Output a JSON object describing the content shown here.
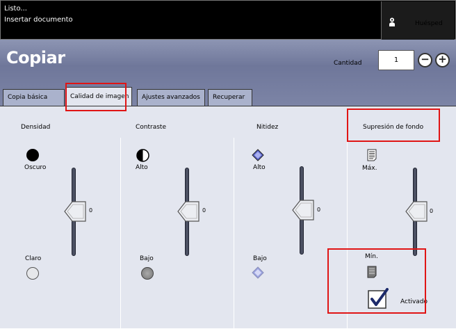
{
  "status": {
    "line1": "Listo...",
    "line2": "Insertar documento"
  },
  "guest": {
    "label": "Huésped",
    "icon": "person-icon"
  },
  "header": {
    "title": "Copiar",
    "quantity_label": "Cantidad",
    "quantity_value": "1",
    "minus": "−",
    "plus": "+"
  },
  "tabs": [
    {
      "label": "Copia básica",
      "active": false
    },
    {
      "label": "Calidad de imagen",
      "active": true
    },
    {
      "label": "Ajustes avanzados",
      "active": false
    },
    {
      "label": "Recuperar",
      "active": false
    }
  ],
  "columns": {
    "density": {
      "title": "Densidad",
      "top": "Oscuro",
      "bottom": "Claro",
      "value": "0"
    },
    "contrast": {
      "title": "Contraste",
      "top": "Alto",
      "bottom": "Bajo",
      "value": "0"
    },
    "sharpness": {
      "title": "Nitidez",
      "top": "Alto",
      "bottom": "Bajo",
      "value": "0"
    },
    "background": {
      "title": "Supresión de fondo",
      "top": "Máx.",
      "bottom": "Mín.",
      "value": "0",
      "checkbox_label": "Activado",
      "checked": true
    }
  },
  "colors": {
    "highlight": "#e01414",
    "header": "#7c84a6",
    "panel": "#e3e6ef"
  }
}
